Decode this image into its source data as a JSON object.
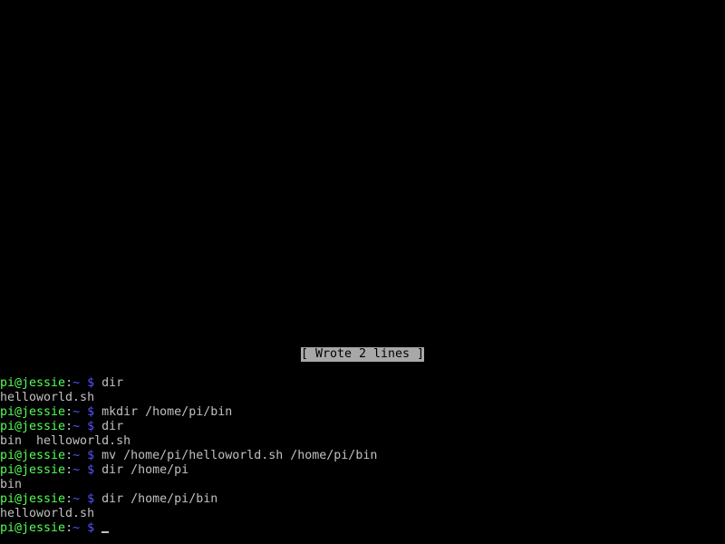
{
  "colors": {
    "background": "#000000",
    "text": "#c0c0c0",
    "user_host": "#54ff54",
    "path_prompt": "#5454ff",
    "status_bg": "#a8a8a8",
    "status_fg": "#000000"
  },
  "status": {
    "message": "[ Wrote 2 lines ]"
  },
  "prompt": {
    "user_host": "pi@jessie",
    "separator": ":",
    "path": "~ $"
  },
  "lines": [
    {
      "type": "prompt",
      "command": "dir"
    },
    {
      "type": "output",
      "text": "helloworld.sh"
    },
    {
      "type": "prompt",
      "command": "mkdir /home/pi/bin"
    },
    {
      "type": "prompt",
      "command": "dir"
    },
    {
      "type": "output",
      "text": "bin  helloworld.sh"
    },
    {
      "type": "prompt",
      "command": "mv /home/pi/helloworld.sh /home/pi/bin"
    },
    {
      "type": "prompt",
      "command": "dir /home/pi"
    },
    {
      "type": "output",
      "text": "bin"
    },
    {
      "type": "prompt",
      "command": "dir /home/pi/bin"
    },
    {
      "type": "output",
      "text": "helloworld.sh"
    },
    {
      "type": "prompt",
      "command": "",
      "cursor": true
    }
  ]
}
